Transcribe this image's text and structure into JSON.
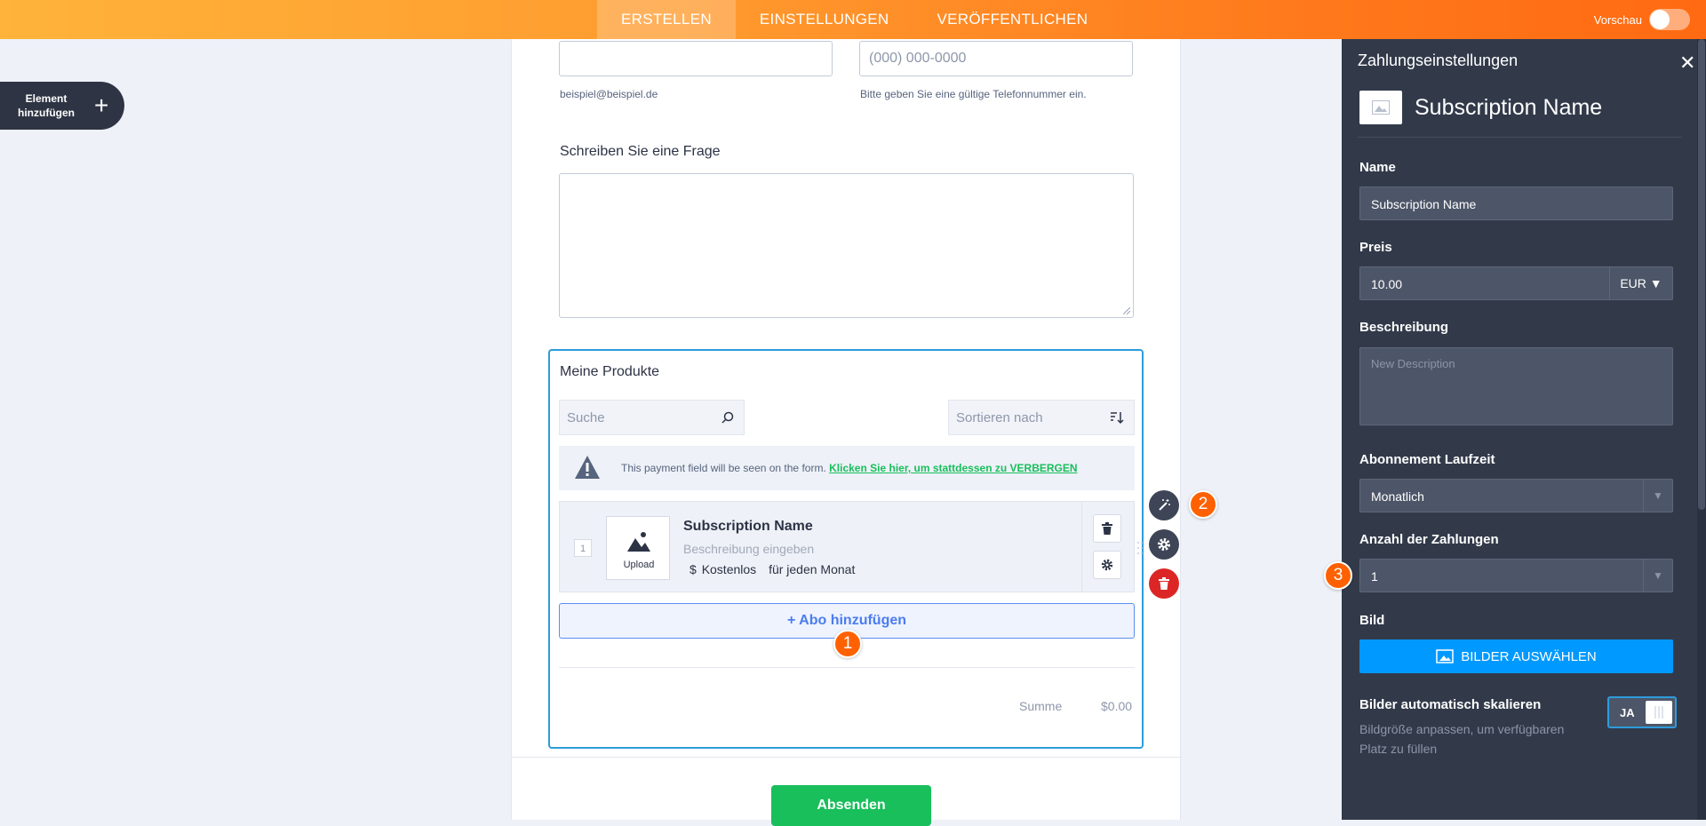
{
  "topbar": {
    "tabs": [
      {
        "label": "ERSTELLEN",
        "active": true
      },
      {
        "label": "EINSTELLUNGEN",
        "active": false
      },
      {
        "label": "VERÖFFENTLICHEN",
        "active": false
      }
    ],
    "preview_label": "Vorschau",
    "preview_on": false
  },
  "add_element": {
    "label_line1": "Element",
    "label_line2": "hinzufügen",
    "icon": "plus-icon"
  },
  "form": {
    "email_hint": "beispiel@beispiel.de",
    "phone_placeholder": "(000) 000-0000",
    "phone_hint": "Bitte geben Sie eine gültige Telefonnummer ein.",
    "question_label": "Schreiben Sie eine Frage",
    "products": {
      "title": "Meine Produkte",
      "search_placeholder": "Suche",
      "sort_placeholder": "Sortieren nach",
      "notice_text": "This payment field will be seen on the form.",
      "notice_link": "Klicken Sie hier, um stattdessen zu VERBERGEN",
      "item": {
        "index": "1",
        "upload_label": "Upload",
        "name": "Subscription Name",
        "description_placeholder": "Beschreibung eingeben",
        "currency_symbol": "$",
        "price": "Kostenlos",
        "period": "für jeden Monat"
      },
      "add_subscription": "+ Abo hinzufügen",
      "sum_label": "Summe",
      "sum_value": "$0.00"
    },
    "submit_label": "Absenden"
  },
  "badges": [
    "1",
    "2",
    "3"
  ],
  "panel": {
    "title": "Zahlungseinstellungen",
    "product_name": "Subscription Name",
    "name_label": "Name",
    "name_value": "Subscription Name",
    "price_label": "Preis",
    "price_value": "10.00",
    "currency": "EUR",
    "description_label": "Beschreibung",
    "description_placeholder": "New Description",
    "duration_label": "Abonnement Laufzeit",
    "duration_value": "Monatlich",
    "payments_label": "Anzahl der Zahlungen",
    "payments_value": "1",
    "image_label": "Bild",
    "image_button": "BILDER AUSWÄHLEN",
    "autoscale_label": "Bilder automatisch skalieren",
    "autoscale_help": "Bildgröße anpassen, um verfügbaren Platz zu füllen",
    "autoscale_toggle": "JA"
  },
  "colors": {
    "accent_orange": "#ff6100",
    "brand_green": "#18bf5b",
    "panel_bg": "#323a4a",
    "select_blue": "#2d9cdb",
    "button_blue": "#0099ff",
    "delete_red": "#dc2626"
  }
}
